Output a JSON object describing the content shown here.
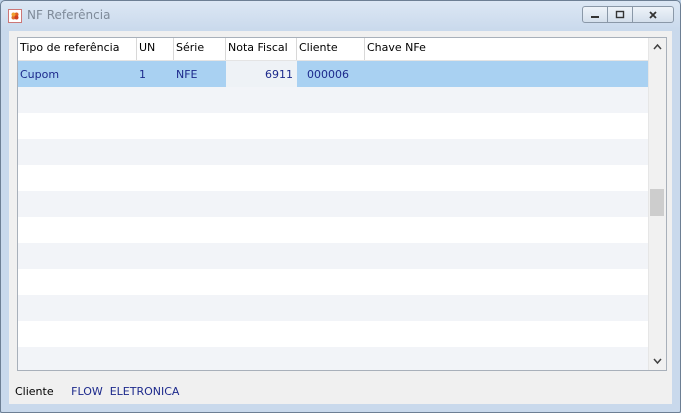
{
  "window": {
    "title": "NF Referência"
  },
  "grid": {
    "columns": [
      "Tipo de referência",
      "UN",
      "Série",
      "Nota Fiscal",
      "Cliente",
      "Chave NFe"
    ],
    "rows": [
      {
        "tipo": "Cupom",
        "un": "1",
        "serie": "NFE",
        "nota": "6911",
        "cliente": "000006",
        "chave": ""
      }
    ]
  },
  "footer": {
    "label": "Cliente",
    "value": "FLOW  ELETRONICA"
  },
  "icons": {
    "minimize": "minimize-icon",
    "maximize": "restore-icon",
    "close": "close-icon",
    "scroll_up": "chevron-up-icon",
    "scroll_down": "chevron-down-icon"
  }
}
